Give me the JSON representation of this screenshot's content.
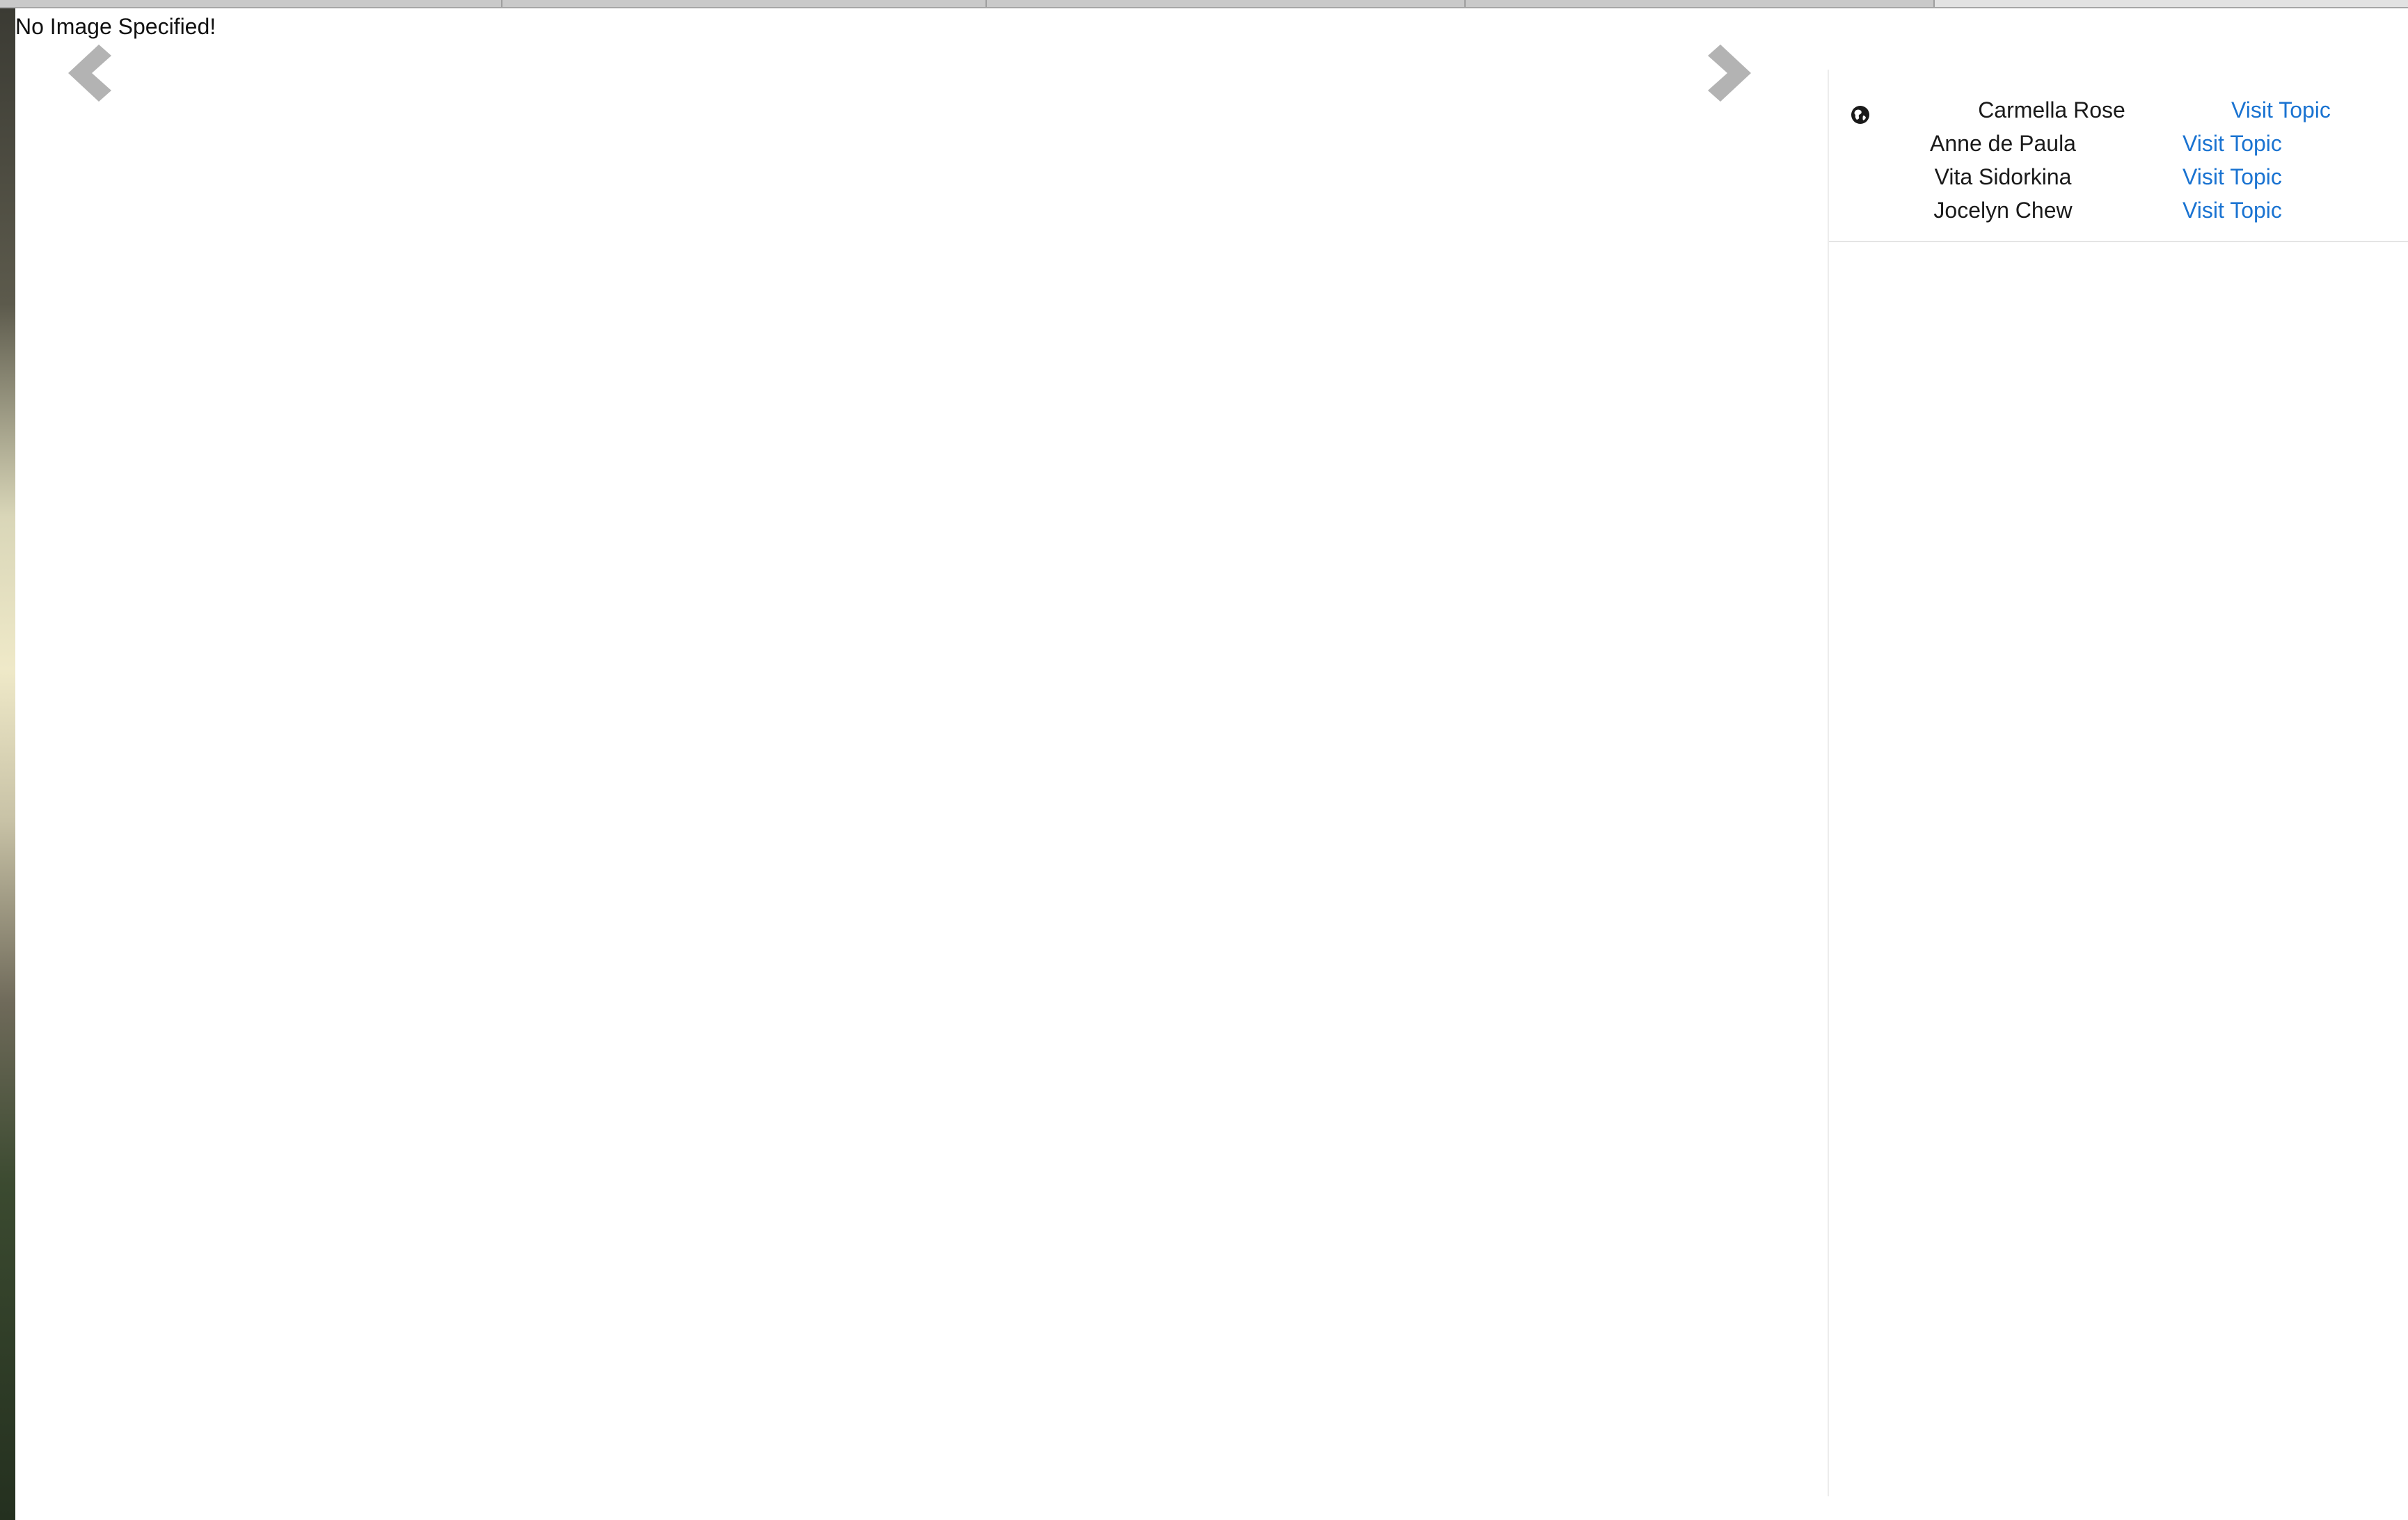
{
  "status_text": "No Image Specified!",
  "navigation": {
    "prev_icon": "chevron-left-icon",
    "next_icon": "chevron-right-icon",
    "arrow_color": "#b3b3b3"
  },
  "sidebar": {
    "globe_icon": "globe-icon",
    "link_color": "#1a73d1",
    "items": [
      {
        "name": "Carmella Rose",
        "link_label": "Visit Topic"
      },
      {
        "name": "Anne de Paula",
        "link_label": "Visit Topic"
      },
      {
        "name": "Vita Sidorkina",
        "link_label": "Visit Topic"
      },
      {
        "name": "Jocelyn Chew",
        "link_label": "Visit Topic"
      }
    ]
  }
}
